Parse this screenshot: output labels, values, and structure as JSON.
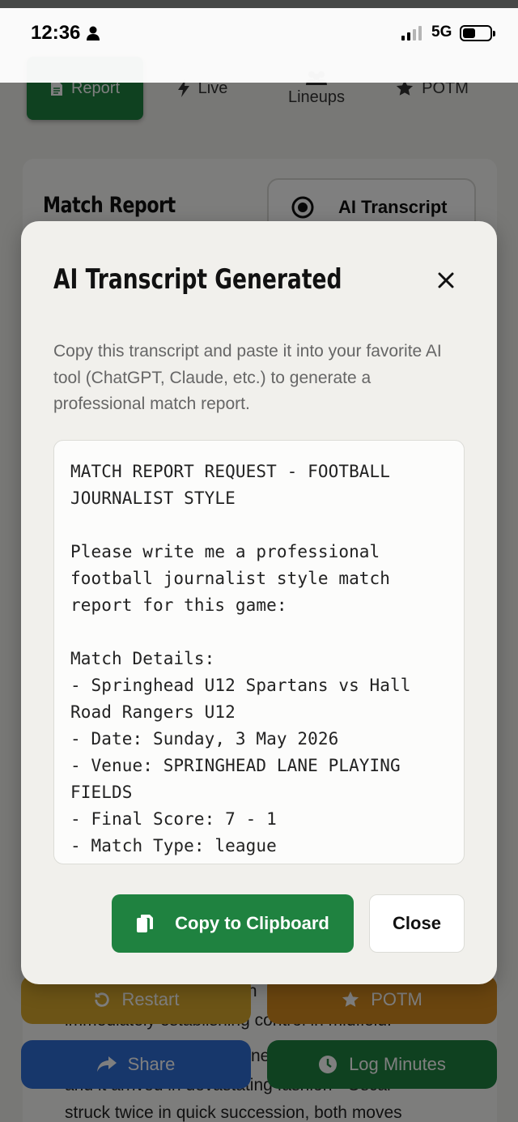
{
  "status_bar": {
    "time": "12:36",
    "network": "5G"
  },
  "tabs": [
    {
      "label": "Report",
      "icon": "document-icon",
      "active": true
    },
    {
      "label": "Live",
      "icon": "bolt-icon",
      "active": false
    },
    {
      "label": "Lineups",
      "icon": "people-icon",
      "active": false
    },
    {
      "label": "POTM",
      "icon": "star-icon",
      "active": false
    }
  ],
  "background": {
    "card_title": "Match Report",
    "ai_transcript_button": "AI Transcript",
    "report_lines": [
      "immediately establishing control in midfield.",
      "and it arrived in devastating fashion - Oscar",
      "struck twice in quick succession, both moves"
    ],
    "partial_words": [
      "th",
      "ne"
    ],
    "restart_label": "Restart",
    "potm_label": "POTM",
    "share_label": "Share",
    "log_minutes_label": "Log Minutes"
  },
  "modal": {
    "title": "AI Transcript Generated",
    "description": "Copy this transcript and paste it into your favorite AI tool (ChatGPT, Claude, etc.) to generate a professional match report.",
    "transcript": "MATCH REPORT REQUEST - FOOTBALL JOURNALIST STYLE\n\nPlease write me a professional football journalist style match report for this game:\n\nMatch Details:\n- Springhead U12 Spartans vs Hall Road Rangers U12\n- Date: Sunday, 3 May 2026\n- Venue: SPRINGHEAD LANE PLAYING FIELDS\n- Final Score: 7 - 1\n- Match Type: league",
    "copy_label": "Copy to Clipboard",
    "close_label": "Close"
  },
  "colors": {
    "primary_green": "#1f8240",
    "restart_yellow": "#d9a82c",
    "potm_orange": "#d48a1e",
    "share_blue": "#2f6fd6",
    "log_green": "#1f8240"
  }
}
